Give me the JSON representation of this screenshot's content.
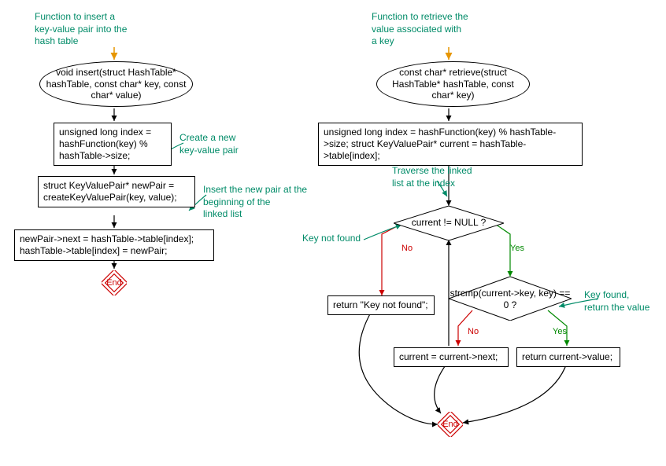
{
  "left": {
    "comment_top": "Function to insert a\nkey-value pair into the\nhash table",
    "start": "void insert(struct HashTable*\nhashTable, const char*\nkey, const char* value)",
    "box1": "unsigned long index =\nhashFunction(key) %\nhashTable->size;",
    "comment_box1": "Create a new\nkey-value pair",
    "box2": "struct KeyValuePair* newPair\n= createKeyValuePair(key,\nvalue);",
    "comment_box2": "Insert the new pair at the\nbeginning of the\nlinked list",
    "box3": "newPair->next = hashTable->table[index];\nhashTable->table[index] = newPair;",
    "end": "End"
  },
  "right": {
    "comment_top": "Function to retrieve the\nvalue associated with\na key",
    "start": "const char* retrieve(struct\nHashTable* hashTable, const\nchar* key)",
    "box1": "unsigned long index = hashFunction(key) % hashTable->size;\nstruct KeyValuePair* current = hashTable->table[index];",
    "comment_traverse": "Traverse the linked\nlist at the index",
    "diamond1": "current != NULL ?",
    "comment_notfound": "Key not found",
    "box_notfound": "return \"Key not found\";",
    "diamond2": "strcmp(current->key,\nkey) == 0 ?",
    "comment_found": "Key found,\nreturn the value",
    "box_next": "current = current->next;",
    "box_return": "return current->value;",
    "end": "End",
    "yes": "Yes",
    "no": "No"
  }
}
